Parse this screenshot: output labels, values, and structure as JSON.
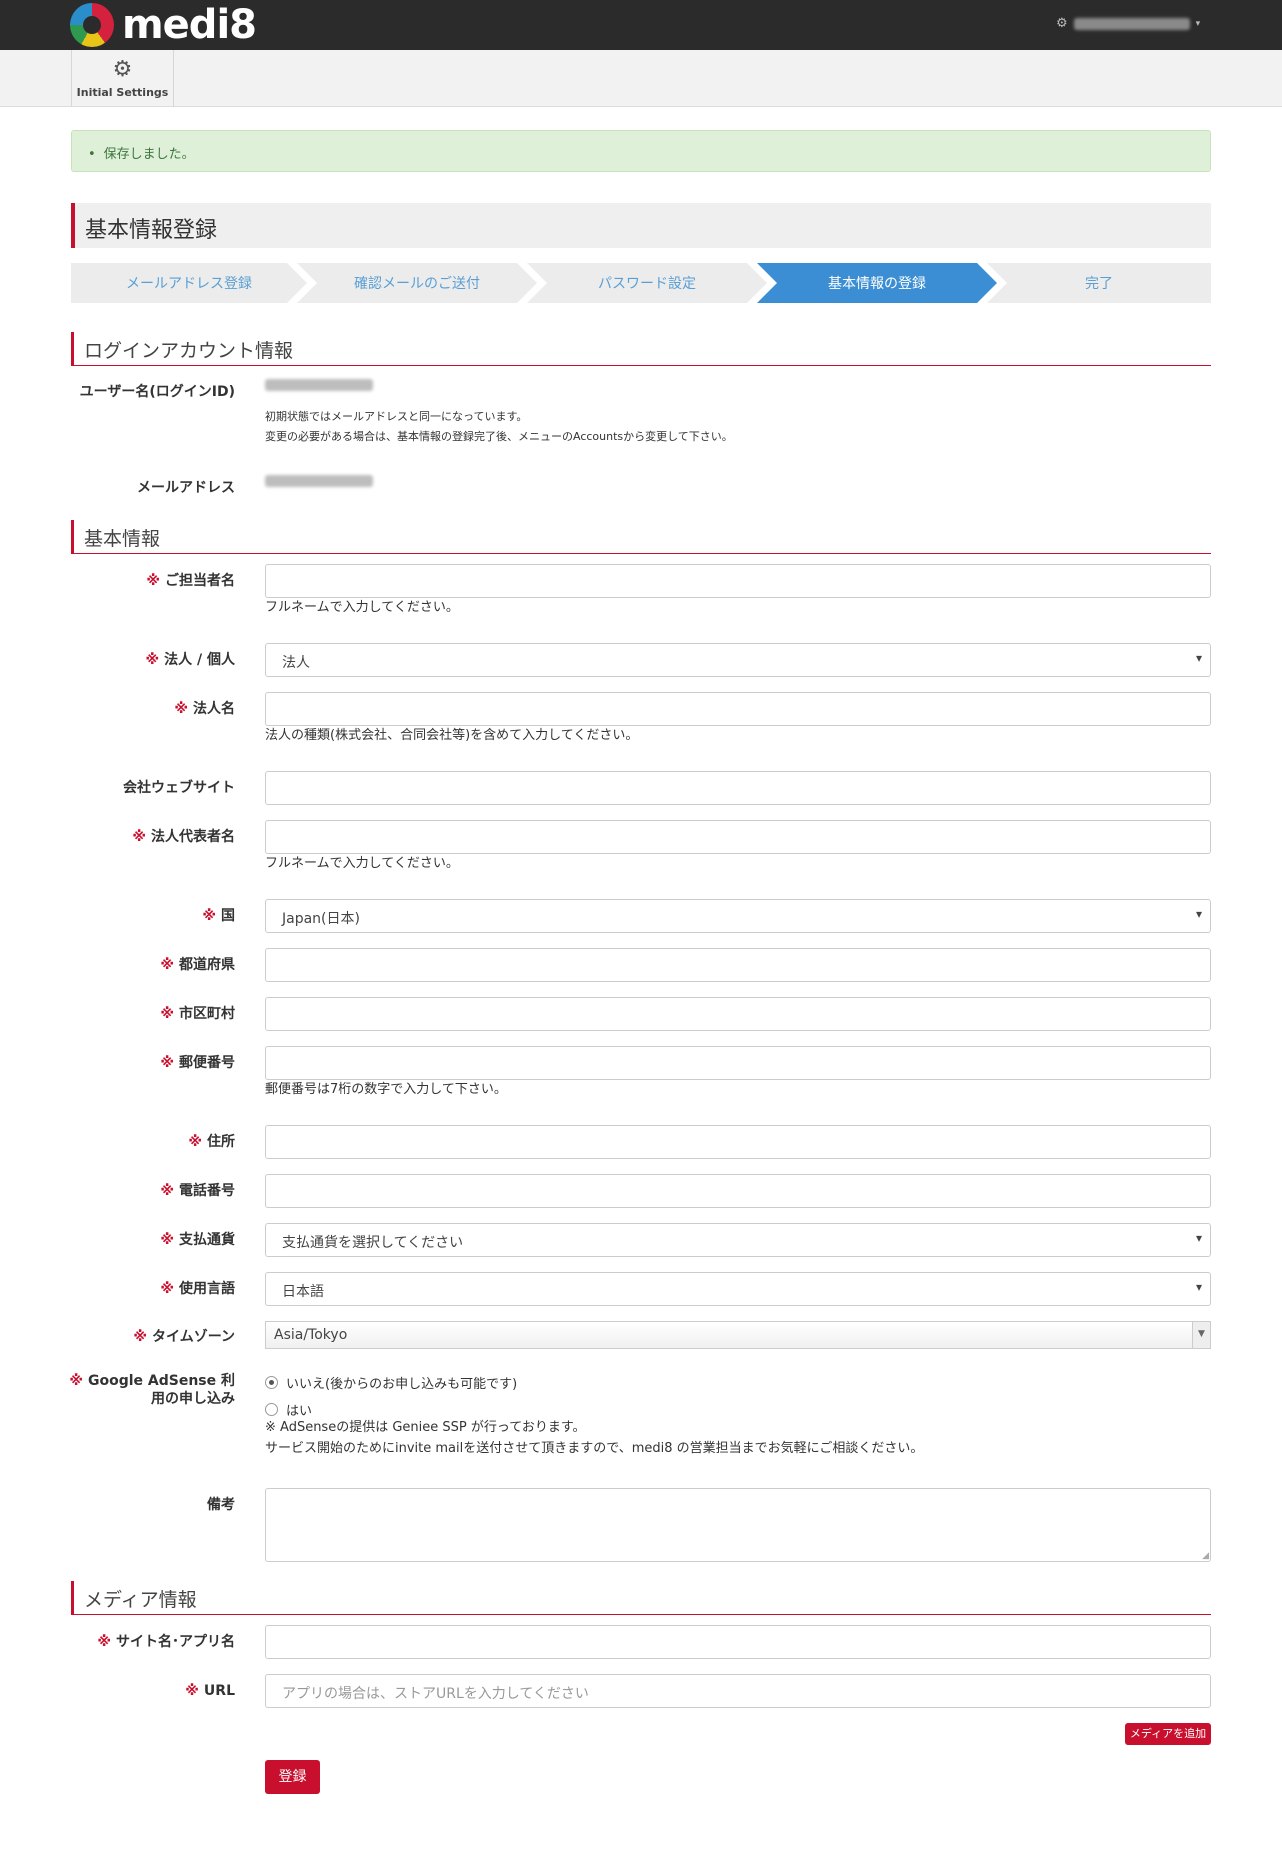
{
  "brand": {
    "name": "medi8"
  },
  "subnav": {
    "item_label": "Initial Settings"
  },
  "alert": {
    "message": "保存しました。"
  },
  "page": {
    "title": "基本情報登録"
  },
  "steps": [
    {
      "label": "メールアドレス登録",
      "active": false
    },
    {
      "label": "確認メールのご送付",
      "active": false
    },
    {
      "label": "パスワード設定",
      "active": false
    },
    {
      "label": "基本情報の登録",
      "active": true
    },
    {
      "label": "完了",
      "active": false
    }
  ],
  "login_section": {
    "heading": "ログインアカウント情報",
    "username_label": "ユーザー名(ログインID)",
    "username_note_1": "初期状態ではメールアドレスと同一になっています。",
    "username_note_2": "変更の必要がある場合は、基本情報の登録完了後、メニューのAccountsから変更して下さい。",
    "email_label": "メールアドレス"
  },
  "basic_section": {
    "heading": "基本情報",
    "required_mark": "※",
    "contact_name_label": "ご担当者名",
    "contact_name_help": "フルネームで入力してください。",
    "entity_type_label": "法人 / 個人",
    "entity_type_value": "法人",
    "company_name_label": "法人名",
    "company_name_help": "法人の種類(株式会社、合同会社等)を含めて入力してください。",
    "website_label": "会社ウェブサイト",
    "representative_label": "法人代表者名",
    "representative_help": "フルネームで入力してください。",
    "country_label": "国",
    "country_value": "Japan(日本)",
    "prefecture_label": "都道府県",
    "city_label": "市区町村",
    "postal_label": "郵便番号",
    "postal_help": "郵便番号は7桁の数字で入力して下さい。",
    "address_label": "住所",
    "phone_label": "電話番号",
    "currency_label": "支払通貨",
    "currency_value": "支払通貨を選択してください",
    "language_label": "使用言語",
    "language_value": "日本語",
    "timezone_label": "タイムゾーン",
    "timezone_value": "Asia/Tokyo",
    "adsense_label_1": "Google AdSense 利",
    "adsense_label_2": "用の申し込み",
    "adsense_option_no": "いいえ(後からのお申し込みも可能です)",
    "adsense_option_yes": "はい",
    "adsense_note_1": "※ AdSenseの提供は Geniee SSP が行っております。",
    "adsense_note_2": "サービス開始のためにinvite mailを送付させて頂きますので、medi8 の営業担当までお気軽にご相談ください。",
    "remarks_label": "備考"
  },
  "media_section": {
    "heading": "メディア情報",
    "site_name_label": "サイト名･アプリ名",
    "url_label": "URL",
    "url_placeholder": "アプリの場合は、ストアURLを入力してください",
    "add_media_button": "メディアを追加",
    "submit_button": "登録"
  }
}
